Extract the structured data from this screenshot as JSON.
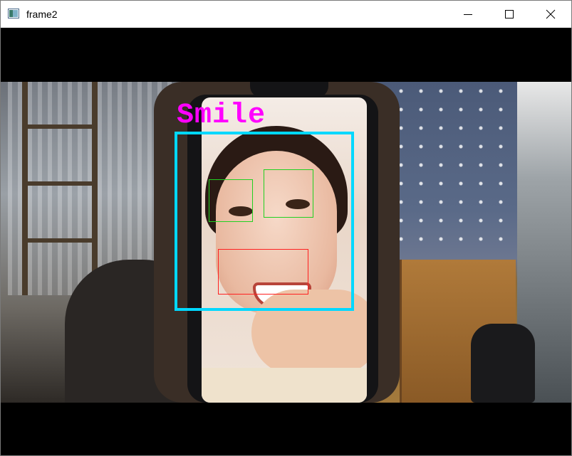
{
  "window": {
    "title": "frame2",
    "icons": {
      "app": "app-window-icon",
      "minimize": "minimize-icon",
      "maximize": "maximize-icon",
      "close": "close-icon"
    }
  },
  "detection": {
    "label": "Smile",
    "colors": {
      "label": "#ff00ff",
      "face_box": "#00d8ff",
      "eye_box": "#21d121",
      "smile_box": "#ff2020"
    }
  }
}
